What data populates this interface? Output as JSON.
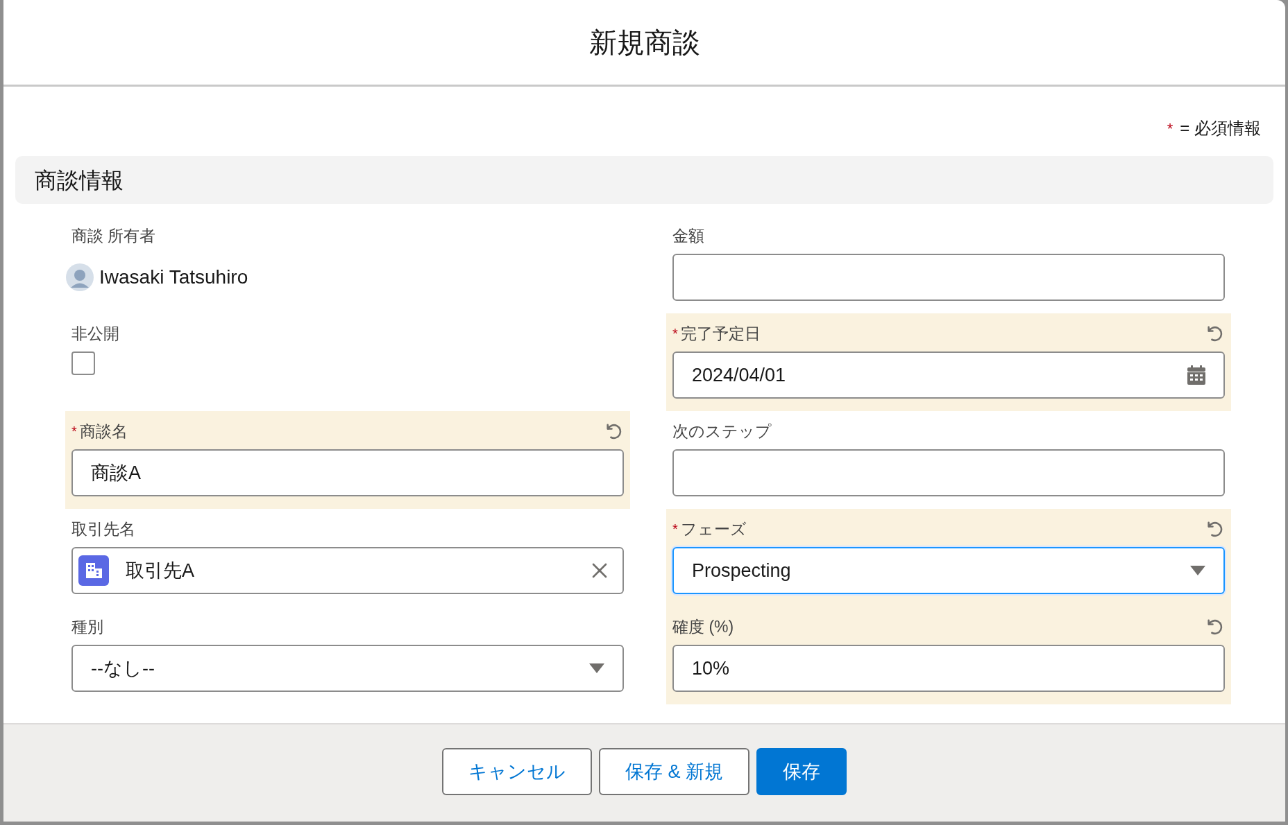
{
  "modal": {
    "title": "新規商談",
    "required_note": {
      "mark": "*",
      "text": "= 必須情報"
    },
    "section": {
      "title": "商談情報"
    },
    "left_fields": [
      {
        "kind": "owner",
        "label": "商談 所有者",
        "value": "Iwasaki Tatsuhiro",
        "required": false,
        "edited": false
      },
      {
        "kind": "checkbox",
        "label": "非公開",
        "checked": false,
        "required": false,
        "edited": false
      },
      {
        "kind": "text",
        "label": "商談名",
        "value": "商談A",
        "required": true,
        "edited": true
      },
      {
        "kind": "lookup",
        "label": "取引先名",
        "value": "取引先A",
        "required": false,
        "edited": false
      },
      {
        "kind": "select",
        "label": "種別",
        "value": "--なし--",
        "required": false,
        "edited": false
      }
    ],
    "right_fields": [
      {
        "kind": "text",
        "label": "金額",
        "required": false,
        "edited": false
      },
      {
        "kind": "date",
        "label": "完了予定日",
        "value": "2024/04/01",
        "required": true,
        "edited": true
      },
      {
        "kind": "text",
        "label": "次のステップ",
        "required": false,
        "edited": false
      },
      {
        "kind": "select",
        "label": "フェーズ",
        "value": "Prospecting",
        "required": true,
        "edited": true,
        "focused": true
      },
      {
        "kind": "text",
        "label": "確度 (%)",
        "value": "10%",
        "required": false,
        "edited": true
      }
    ],
    "footer_buttons": [
      {
        "label": "キャンセル",
        "kind": "neutral"
      },
      {
        "label": "保存 & 新規",
        "kind": "neutral"
      },
      {
        "label": "保存",
        "kind": "brand"
      }
    ]
  }
}
